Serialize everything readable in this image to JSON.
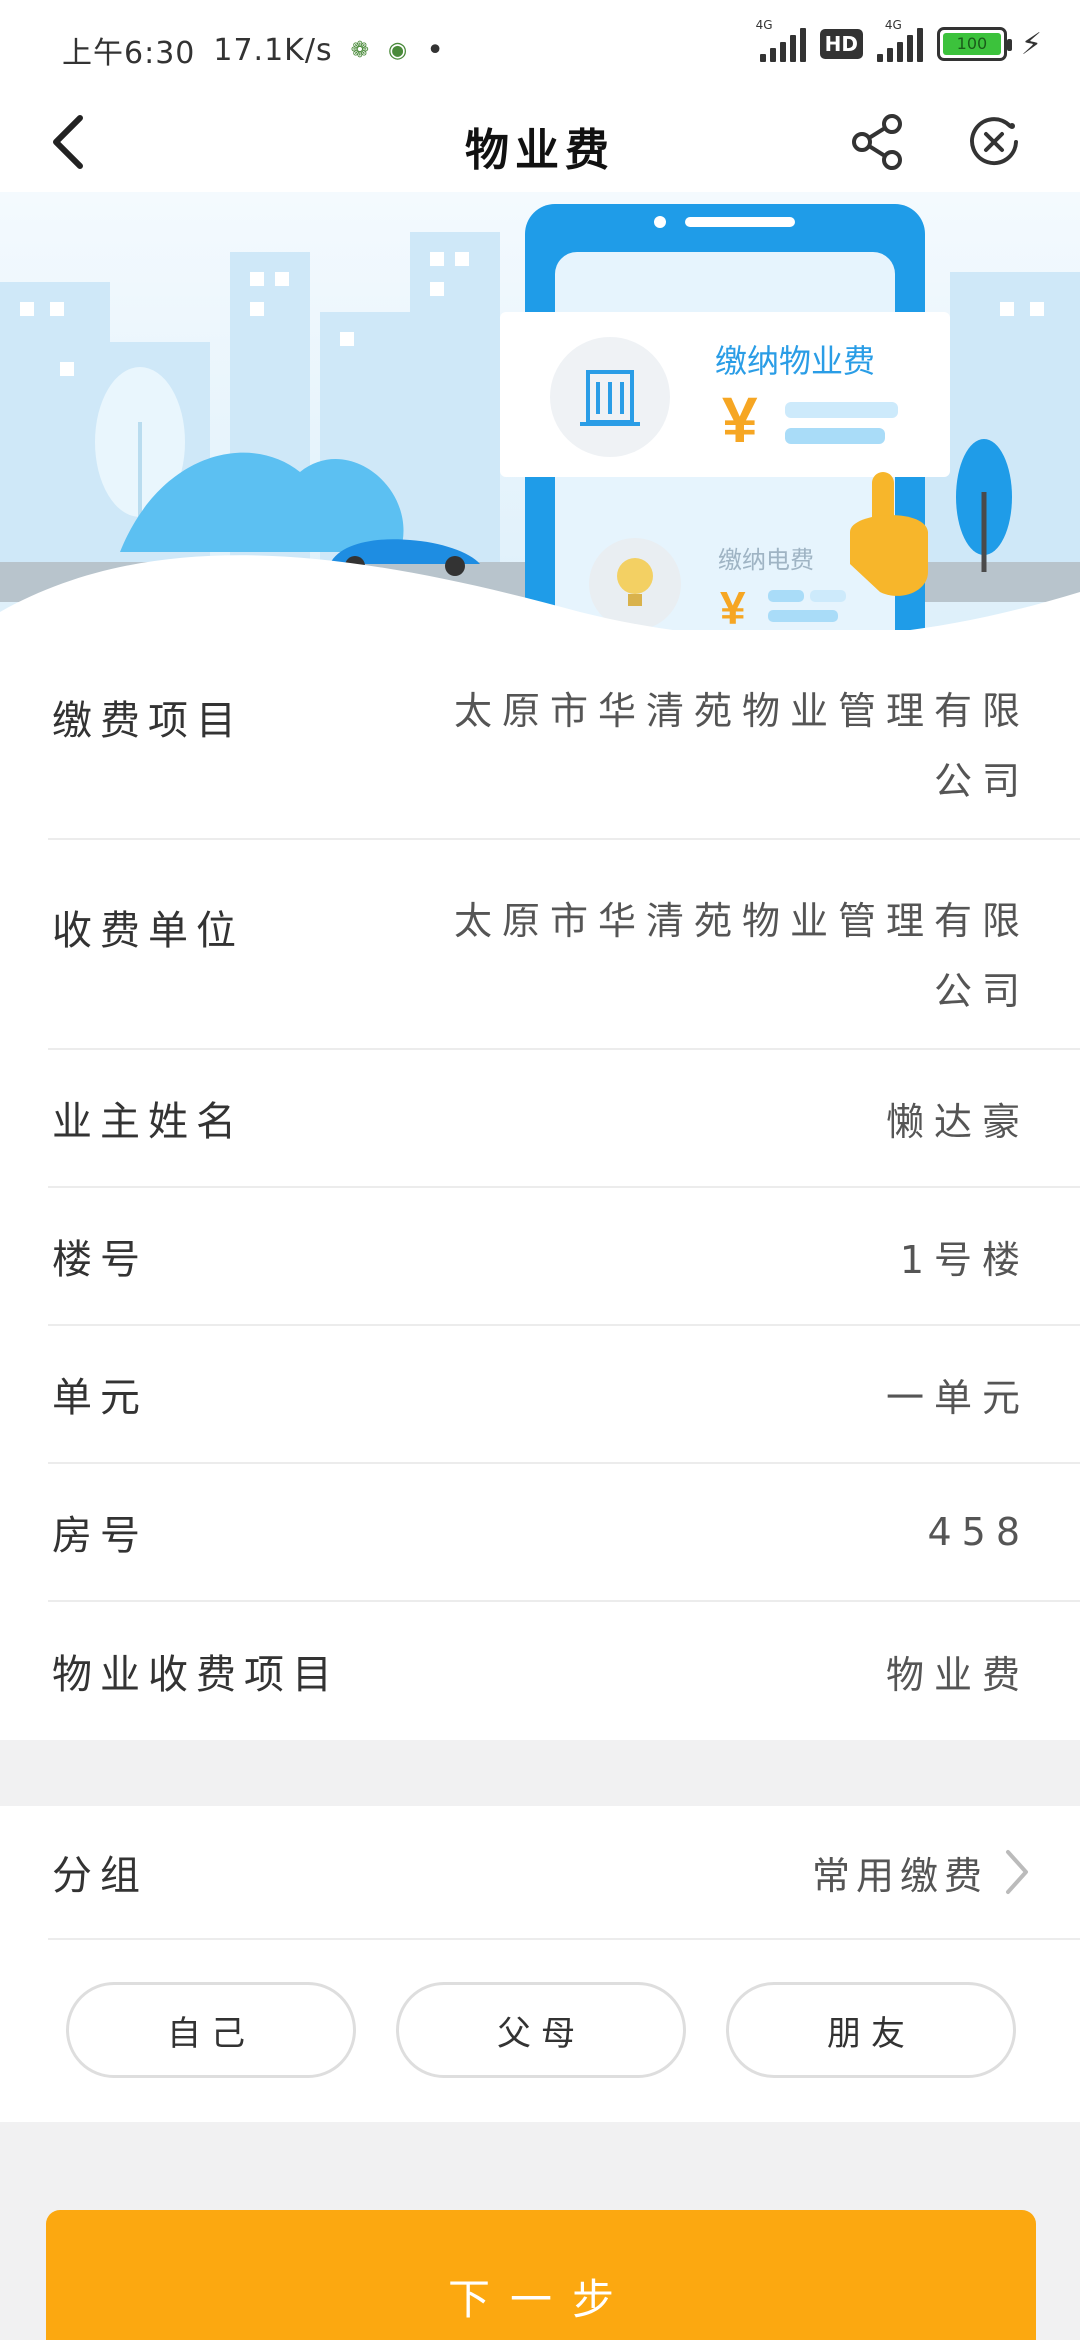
{
  "status_bar": {
    "time": "上午6:30",
    "speed": "17.1K/s",
    "hd_label": "HD",
    "network_label_1": "4G",
    "network_label_2": "4G",
    "battery_level": "100"
  },
  "nav": {
    "title": "物业费",
    "back_icon": "chevron-left-icon",
    "share_icon": "share-icon",
    "close_icon": "close-circle-icon"
  },
  "banner": {
    "card_title": "缴纳物业费",
    "card_currency": "¥",
    "card2_title": "缴纳电费",
    "card2_currency": "¥"
  },
  "info": {
    "rows": [
      {
        "label": "缴费项目",
        "value": "太原市华清苑物业管理有限公司"
      },
      {
        "label": "收费单位",
        "value": "太原市华清苑物业管理有限公司"
      },
      {
        "label": "业主姓名",
        "value": "懒达豪"
      },
      {
        "label": "楼号",
        "value": "1号楼"
      },
      {
        "label": "单元",
        "value": "一单元"
      },
      {
        "label": "房号",
        "value": "458"
      },
      {
        "label": "物业收费项目",
        "value": "物业费"
      }
    ]
  },
  "group": {
    "label": "分组",
    "value": "常用缴费",
    "chips": [
      "自己",
      "父母",
      "朋友"
    ]
  },
  "next_button": {
    "label": "下一步"
  },
  "colors": {
    "accent": "#fca810",
    "banner_blue": "#29a0ea",
    "battery_green": "#3cc23c"
  }
}
